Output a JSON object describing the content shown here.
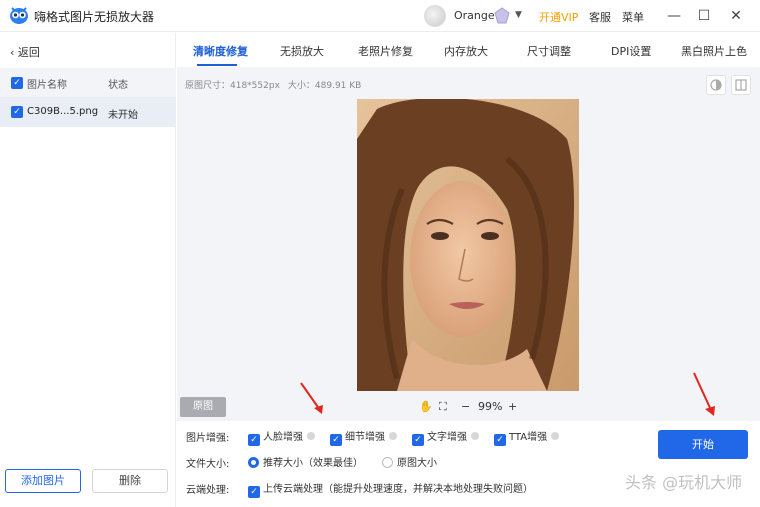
{
  "app": {
    "title": "嗨格式图片无损放大器"
  },
  "titlebar": {
    "username": "Orange",
    "vip_label": "开通VIP",
    "service_label": "客服",
    "menu_label": "菜单",
    "minimize": "—",
    "maximize": "☐",
    "close": "✕"
  },
  "sidebar": {
    "back_label": "返回",
    "header": {
      "name": "图片名称",
      "status": "状态"
    },
    "files": [
      {
        "name": "C309B...5.png",
        "status": "未开始"
      }
    ],
    "add_button": "添加图片",
    "delete_button": "删除"
  },
  "tabs": [
    {
      "label": "清晰度修复",
      "active": true
    },
    {
      "label": "无损放大"
    },
    {
      "label": "老照片修复"
    },
    {
      "label": "内存放大"
    },
    {
      "label": "尺寸调整"
    },
    {
      "label": "DPI设置"
    },
    {
      "label": "黑白照片上色"
    }
  ],
  "image_info": {
    "size": "原图尺寸：418*552px",
    "filesize": "大小：489.91 KB"
  },
  "preview": {
    "original_button": "原图",
    "zoom_minus": "−",
    "zoom_level": "99%",
    "zoom_plus": "+"
  },
  "options": {
    "enhance_label": "图片增强:",
    "enhance_items": [
      "人脸增强",
      "细节增强",
      "文字增强",
      "TTA增强"
    ],
    "filesize_label": "文件大小:",
    "size_options": [
      "推荐大小（效果最佳）",
      "原图大小"
    ],
    "cloud_label": "云端处理:",
    "cloud_option": "上传云端处理（能提升处理速度，并解决本地处理失败问题）"
  },
  "start_button": "开始",
  "watermark": "头条 @玩机大师",
  "colors": {
    "primary": "#2168e8",
    "vip": "#f2a100",
    "annotation_arrow": "#e0271f"
  }
}
